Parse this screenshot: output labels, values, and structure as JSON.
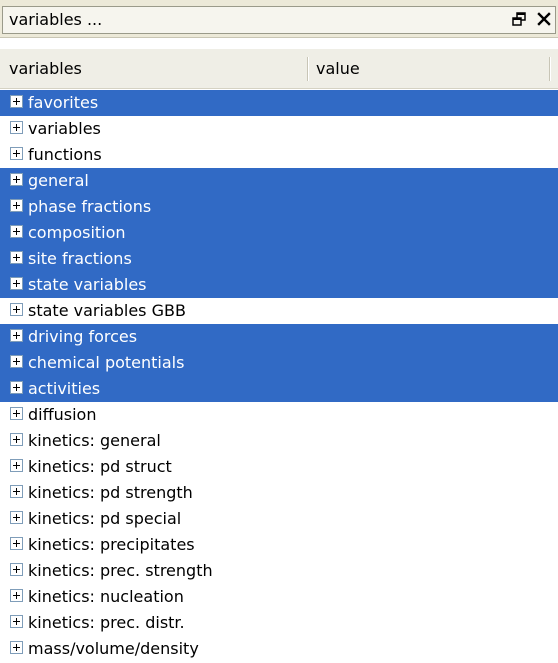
{
  "window": {
    "title": "variables ...",
    "restore_icon": "restore-window-icon",
    "close_icon": "close-icon"
  },
  "columns": {
    "name_header": "variables",
    "value_header": "value"
  },
  "colors": {
    "selection": "#316ac5",
    "selection_text": "#ffffff",
    "background": "#ffffff",
    "titlebar": "#ece9d8"
  },
  "tree": {
    "items": [
      {
        "label": "favorites",
        "selected": true
      },
      {
        "label": "variables",
        "selected": false
      },
      {
        "label": "functions",
        "selected": false
      },
      {
        "label": "general",
        "selected": true
      },
      {
        "label": "phase fractions",
        "selected": true
      },
      {
        "label": "composition",
        "selected": true
      },
      {
        "label": "site fractions",
        "selected": true
      },
      {
        "label": "state variables",
        "selected": true
      },
      {
        "label": "state variables GBB",
        "selected": false
      },
      {
        "label": "driving forces",
        "selected": true
      },
      {
        "label": "chemical potentials",
        "selected": true
      },
      {
        "label": "activities",
        "selected": true
      },
      {
        "label": "diffusion",
        "selected": false
      },
      {
        "label": "kinetics: general",
        "selected": false
      },
      {
        "label": "kinetics: pd struct",
        "selected": false
      },
      {
        "label": "kinetics: pd strength",
        "selected": false
      },
      {
        "label": "kinetics: pd special",
        "selected": false
      },
      {
        "label": "kinetics: precipitates",
        "selected": false
      },
      {
        "label": "kinetics: prec. strength",
        "selected": false
      },
      {
        "label": "kinetics: nucleation",
        "selected": false
      },
      {
        "label": "kinetics: prec. distr.",
        "selected": false
      },
      {
        "label": "mass/volume/density",
        "selected": false
      }
    ]
  }
}
